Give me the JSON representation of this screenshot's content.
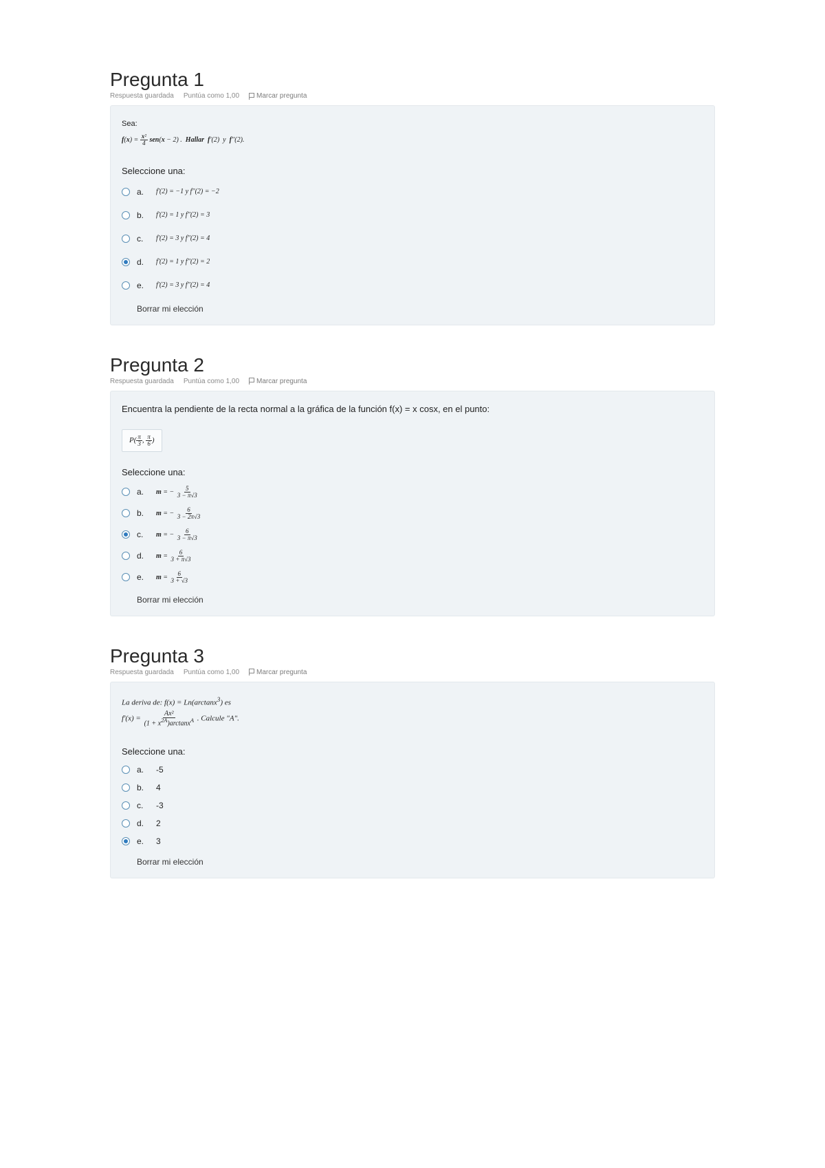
{
  "questions": [
    {
      "title": "Pregunta 1",
      "status": "Respuesta guardada",
      "score": "Puntúa como 1,00",
      "flag": "Marcar pregunta",
      "stem_lead": "Sea:",
      "stem_formula": "f(x) = x²⁄4 · sen(x − 2) .  Hallar  f'(2)  y  f''(2).",
      "select_label": "Seleccione una:",
      "options": [
        {
          "letter": "a.",
          "text": "f'(2) = −1 y f''(2) = −2",
          "selected": false
        },
        {
          "letter": "b.",
          "text": "f'(2) = 1 y f''(2) = 3",
          "selected": false
        },
        {
          "letter": "c.",
          "text": "f'(2) = 3 y f''(2) = 4",
          "selected": false
        },
        {
          "letter": "d.",
          "text": "f'(2) = 1 y f''(2) = 2",
          "selected": true
        },
        {
          "letter": "e.",
          "text": "f'(2) = 3 y f''(2) = 4",
          "selected": false
        }
      ],
      "clear": "Borrar mi elección"
    },
    {
      "title": "Pregunta 2",
      "status": "Respuesta guardada",
      "score": "Puntúa como 1,00",
      "flag": "Marcar pregunta",
      "stem_text": "Encuentra la pendiente de la recta normal a la gráfica de la función f(x) = x cosx, en el punto:",
      "point": "P( π⁄3 , π⁄6 )",
      "select_label": "Seleccione una:",
      "options": [
        {
          "letter": "a.",
          "num": "5",
          "den": "3 − π√3",
          "neg": true,
          "selected": false
        },
        {
          "letter": "b.",
          "num": "6",
          "den": "3 − 2π√3",
          "neg": true,
          "selected": false
        },
        {
          "letter": "c.",
          "num": "6",
          "den": "3 − π√3",
          "neg": true,
          "selected": true
        },
        {
          "letter": "d.",
          "num": "6",
          "den": "3 + π√3",
          "neg": false,
          "selected": false
        },
        {
          "letter": "e.",
          "num": "6",
          "den": "3 + √3",
          "neg": false,
          "selected": false
        }
      ],
      "clear": "Borrar mi elección"
    },
    {
      "title": "Pregunta 3",
      "status": "Respuesta guardada",
      "score": "Puntúa como 1,00",
      "flag": "Marcar pregunta",
      "stem_line1": "La deriva de: f(x) = Ln(arctanx³) es",
      "stem_formula": "f'(x) = Ax² ⁄ ( (1 + x²ᴬ) arctanxᴬ ) . Calcule \"A\".",
      "select_label": "Seleccione una:",
      "options": [
        {
          "letter": "a.",
          "text": "-5",
          "selected": false
        },
        {
          "letter": "b.",
          "text": "4",
          "selected": false
        },
        {
          "letter": "c.",
          "text": "-3",
          "selected": false
        },
        {
          "letter": "d.",
          "text": "2",
          "selected": false
        },
        {
          "letter": "e.",
          "text": "3",
          "selected": true
        }
      ],
      "clear": "Borrar mi elección"
    }
  ]
}
